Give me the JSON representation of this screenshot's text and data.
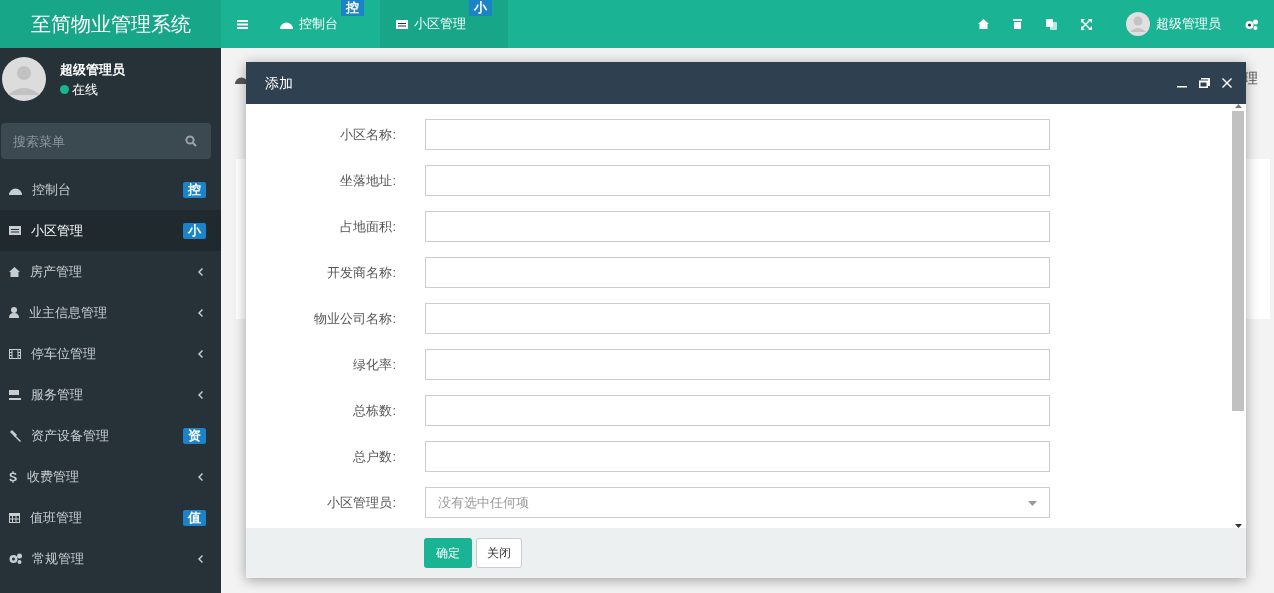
{
  "app_title": "至简物业管理系统",
  "top_tabs": [
    {
      "label": "控制台",
      "badge": "控",
      "selected": false
    },
    {
      "label": "小区管理",
      "badge": "小",
      "selected": true
    }
  ],
  "top_user": "超级管理员",
  "sidebar": {
    "user": {
      "name": "超级管理员",
      "status": "在线"
    },
    "search": {
      "placeholder": "搜索菜单"
    },
    "items": [
      {
        "label": "控制台",
        "badge": "控",
        "has_children": false,
        "selected": false
      },
      {
        "label": "小区管理",
        "badge": "小",
        "has_children": false,
        "selected": true
      },
      {
        "label": "房产管理",
        "has_children": true,
        "selected": false
      },
      {
        "label": "业主信息管理",
        "has_children": true,
        "selected": false
      },
      {
        "label": "停车位管理",
        "has_children": true,
        "selected": false
      },
      {
        "label": "服务管理",
        "has_children": true,
        "selected": false
      },
      {
        "label": "资产设备管理",
        "badge": "资",
        "has_children": false,
        "selected": false
      },
      {
        "label": "收费管理",
        "has_children": true,
        "selected": false
      },
      {
        "label": "值班管理",
        "badge": "值",
        "has_children": false,
        "selected": false
      },
      {
        "label": "常规管理",
        "has_children": true,
        "selected": false
      }
    ]
  },
  "breadcrumb_tail": "理",
  "dialog": {
    "title": "添加",
    "fields": [
      {
        "label": "小区名称:",
        "kind": "text"
      },
      {
        "label": "坐落地址:",
        "kind": "text"
      },
      {
        "label": "占地面积:",
        "kind": "text"
      },
      {
        "label": "开发商名称:",
        "kind": "text"
      },
      {
        "label": "物业公司名称:",
        "kind": "text"
      },
      {
        "label": "绿化率:",
        "kind": "text"
      },
      {
        "label": "总栋数:",
        "kind": "text"
      },
      {
        "label": "总户数:",
        "kind": "text"
      },
      {
        "label": "小区管理员:",
        "kind": "select",
        "placeholder": "没有选中任何项"
      }
    ],
    "buttons": [
      {
        "label": "确定",
        "kind": "primary"
      },
      {
        "label": "关闭",
        "kind": "default"
      }
    ]
  }
}
